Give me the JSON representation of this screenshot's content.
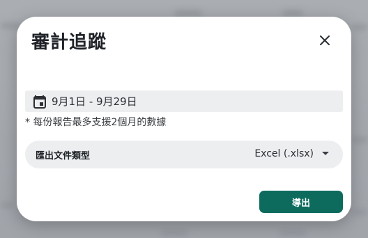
{
  "dialog": {
    "title": "審計追蹤",
    "date_range": "9月1日 - 9月29日",
    "note": "* 每份報告最多支援2個月的數據",
    "file_type": {
      "label": "匯出文件類型",
      "value": "Excel (.xlsx)"
    },
    "export_label": "導出"
  },
  "icons": {
    "close": "close-icon",
    "calendar": "calendar-icon",
    "dropdown": "chevron-down-icon"
  },
  "colors": {
    "primary": "#0d6b5e",
    "field_bg": "#eceef0",
    "overlay": "#b9bdc2"
  }
}
